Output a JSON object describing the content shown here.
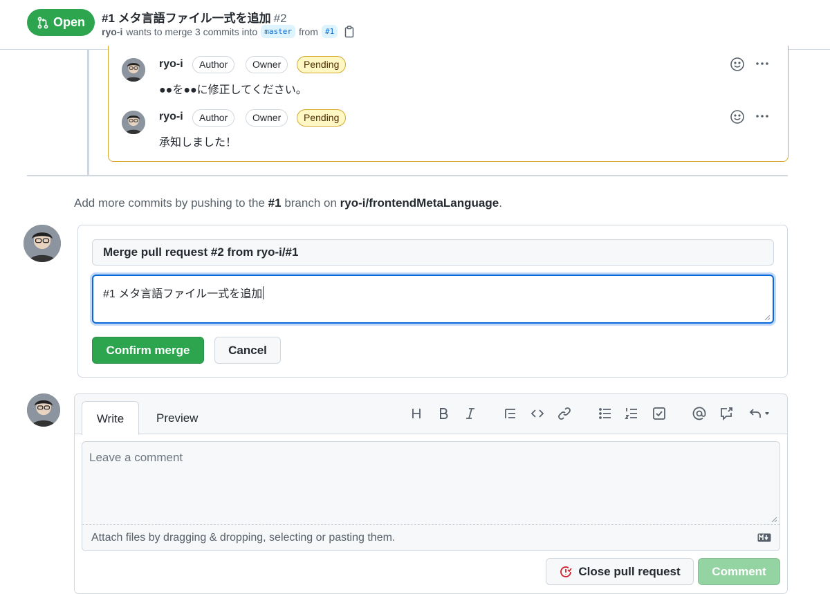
{
  "header": {
    "state_label": "Open",
    "title": "#1 メタ言語ファイル一式を追加",
    "number": "#2",
    "meta_user": "ryo-i",
    "meta_text": "wants to merge 3 commits into",
    "base_branch": "master",
    "from_text": "from",
    "head_branch": "#1"
  },
  "review": {
    "comments": [
      {
        "author": "ryo-i",
        "labels": [
          "Author",
          "Owner",
          "Pending"
        ],
        "body": "●●を●●に修正してください。"
      },
      {
        "author": "ryo-i",
        "labels": [
          "Author",
          "Owner",
          "Pending"
        ],
        "body": "承知しました！"
      }
    ]
  },
  "add_commits": {
    "prefix": "Add more commits by pushing to the",
    "branch": "#1",
    "middle": "branch on",
    "repo": "ryo-i/frontendMetaLanguage",
    "suffix": "."
  },
  "merge": {
    "title_value": "Merge pull request #2 from ryo-i/#1",
    "message_value": "#1 メタ言語ファイル一式を追加",
    "confirm_label": "Confirm merge",
    "cancel_label": "Cancel"
  },
  "comment": {
    "tab_write": "Write",
    "tab_preview": "Preview",
    "placeholder": "Leave a comment",
    "attach_text": "Attach files by dragging & dropping, selecting or pasting them.",
    "close_label": "Close pull request",
    "comment_label": "Comment"
  },
  "colors": {
    "green": "#2da44e",
    "pending_border": "#d4a72c",
    "pending_bg": "#fff8c5",
    "focus_blue": "#0969da"
  },
  "icons": {
    "toolbar": [
      "heading-icon",
      "bold-icon",
      "italic-icon",
      "quote-icon",
      "code-icon",
      "link-icon",
      "unordered-list-icon",
      "ordered-list-icon",
      "task-list-icon",
      "mention-icon",
      "reference-icon",
      "reply-icon"
    ]
  }
}
